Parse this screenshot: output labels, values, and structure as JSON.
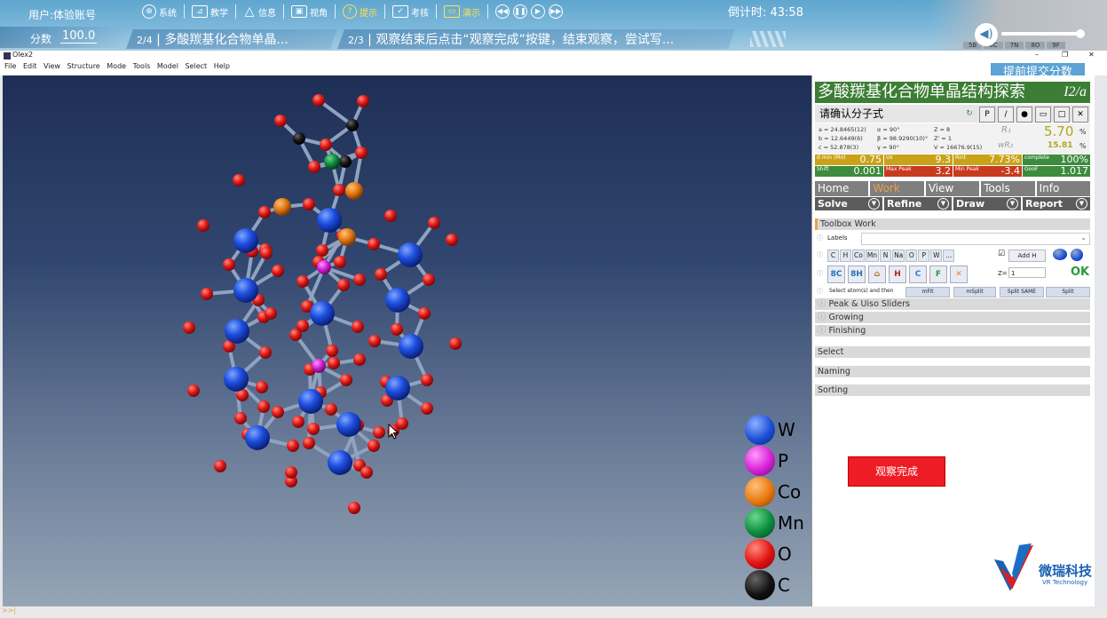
{
  "vr": {
    "user": "用户:体验账号",
    "score_label": "分数",
    "score_value": "100.0",
    "menu": [
      {
        "icon": "globe-icon",
        "glyph": "⊕",
        "label": "系统"
      },
      {
        "icon": "teach-icon",
        "glyph": "⊿",
        "label": "教学"
      },
      {
        "icon": "warning-icon",
        "glyph": "△",
        "label": "信息"
      },
      {
        "icon": "image-icon",
        "glyph": "▣",
        "label": "视角"
      },
      {
        "icon": "question-icon",
        "glyph": "?",
        "label": "提示"
      },
      {
        "icon": "clipboard-icon",
        "glyph": "✓",
        "label": "考核"
      },
      {
        "icon": "monitor-icon",
        "glyph": "▭",
        "label": "演示"
      }
    ],
    "countdown": "倒计时: 43:58",
    "step1_num": "2/4",
    "step1_text": "多酸羰基化合物单晶...",
    "step2_num": "2/3",
    "step2_text": "观察结束后点击“观察完成”按键，结束观察，尝试写...",
    "submit_label": "提前提交分数",
    "done_label": "观察完成",
    "logo_cn": "微瑞科技",
    "logo_en": "VR Technology",
    "bg_labels": [
      "5B",
      "6C",
      "7N",
      "8O",
      "9F"
    ]
  },
  "olex": {
    "title": "Olex2",
    "menu": [
      "File",
      "Edit",
      "View",
      "Structure",
      "Mode",
      "Tools",
      "Model",
      "Select",
      "Help"
    ],
    "legend": [
      {
        "label": "W",
        "color": "#1c4fd8"
      },
      {
        "label": "P",
        "color": "#d620d6"
      },
      {
        "label": "Co",
        "color": "#e8780e"
      },
      {
        "label": "Mn",
        "color": "#0b8c3c"
      },
      {
        "label": "O",
        "color": "#e01010"
      },
      {
        "label": "C",
        "color": "#111111"
      }
    ]
  },
  "panel": {
    "title": "多酸羰基化合物单晶结构探索",
    "space_group": "I2/a",
    "formula_label": "请确认分子式",
    "cell": {
      "a": "a = 24.8465(12)",
      "b": "b = 12.6449(6)",
      "c": "c = 52.878(3)",
      "alpha": "α = 90°",
      "beta": "β = 98.9290(10)°",
      "gamma": "γ = 90°",
      "z": "Z = 8",
      "zp": "Z' = 1",
      "v": "V = 16676.9(15)",
      "r1_label": "R₁",
      "r1": "5.70",
      "wr2_label": "wR₂",
      "wr2": "15.81",
      "pct": "%"
    },
    "stats": [
      {
        "label": "d min (Mo)",
        "value": "0.75",
        "color": "#c9a21a"
      },
      {
        "label": "I/σ",
        "value": "9.3",
        "color": "#c9a21a"
      },
      {
        "label": "Rint",
        "value": "7.73%",
        "color": "#c9a21a"
      },
      {
        "label": "complete",
        "value": "100%",
        "color": "#3d8b3d"
      },
      {
        "label": "Shift",
        "value": "0.001",
        "color": "#3d8b3d"
      },
      {
        "label": "Max Peak",
        "value": "3.2",
        "color": "#c83a1e"
      },
      {
        "label": "Min Peak",
        "value": "-3.4",
        "color": "#c83a1e"
      },
      {
        "label": "GooF",
        "value": "1.017",
        "color": "#3d8b3d"
      }
    ],
    "tabs": [
      "Home",
      "Work",
      "View",
      "Tools",
      "Info"
    ],
    "subtabs": [
      "Solve",
      "Refine",
      "Draw",
      "Report"
    ],
    "toolbox": "Toolbox Work",
    "labels": "Labels",
    "atoms": [
      "C",
      "H",
      "Co",
      "Mn",
      "N",
      "Na",
      "O",
      "P",
      "W",
      "..."
    ],
    "add_h": "Add H",
    "z_label": "Z=",
    "z_value": "1",
    "ok": "OK",
    "select_text": "Select atom(s) and then",
    "split_buttons": [
      "mFit",
      "mSplit",
      "Split SAME",
      "Split"
    ],
    "sub_sections": [
      "Peak & Uiso Sliders",
      "Growing",
      "Finishing"
    ],
    "sections": [
      "Select",
      "Naming",
      "Sorting"
    ]
  }
}
